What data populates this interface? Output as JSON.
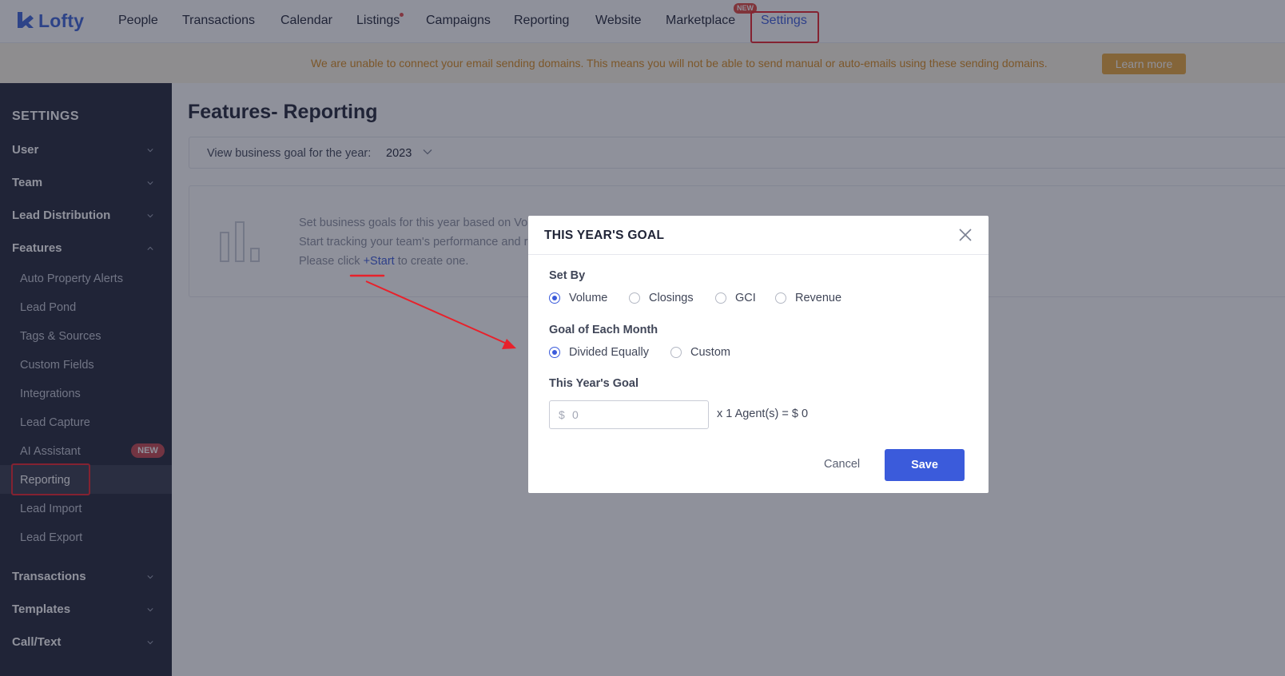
{
  "brand": {
    "name": "Lofty",
    "color": "#3b62d8"
  },
  "topnav": {
    "items": [
      {
        "label": "People"
      },
      {
        "label": "Transactions"
      },
      {
        "label": "Calendar"
      },
      {
        "label": "Listings"
      },
      {
        "label": "Campaigns"
      },
      {
        "label": "Reporting"
      },
      {
        "label": "Website"
      },
      {
        "label": "Marketplace",
        "badge": "NEW"
      },
      {
        "label": "Settings",
        "active": true
      }
    ]
  },
  "banner": {
    "message": "We are unable to connect your email sending domains. This means you will not be able to send manual or auto-emails using these sending domains.",
    "button": "Learn more"
  },
  "sidebar": {
    "title": "SETTINGS",
    "groups": [
      {
        "label": "User",
        "expanded": false
      },
      {
        "label": "Team",
        "expanded": false
      },
      {
        "label": "Lead Distribution",
        "expanded": false
      },
      {
        "label": "Features",
        "expanded": true
      },
      {
        "label": "Transactions",
        "expanded": false
      },
      {
        "label": "Templates",
        "expanded": false
      },
      {
        "label": "Call/Text",
        "expanded": false
      }
    ],
    "feature_items": [
      {
        "label": "Auto Property Alerts"
      },
      {
        "label": "Lead Pond"
      },
      {
        "label": "Tags & Sources"
      },
      {
        "label": "Custom Fields"
      },
      {
        "label": "Integrations"
      },
      {
        "label": "Lead Capture"
      },
      {
        "label": "AI Assistant",
        "badge": "NEW"
      },
      {
        "label": "Reporting",
        "active": true
      },
      {
        "label": "Lead Import"
      },
      {
        "label": "Lead Export"
      }
    ]
  },
  "main": {
    "title": "Features- Reporting",
    "year_label": "View business goal for the year:",
    "year_value": "2023",
    "empty_state": {
      "line1": "Set business goals for this year based on Volu",
      "line2": "Start tracking your team's performance and re",
      "line3_prefix": "Please click ",
      "line3_link": "+Start",
      "line3_suffix": " to create one."
    }
  },
  "modal": {
    "title": "THIS YEAR'S GOAL",
    "set_by_label": "Set By",
    "set_by_options": [
      {
        "label": "Volume",
        "checked": true
      },
      {
        "label": "Closings",
        "checked": false
      },
      {
        "label": "GCI",
        "checked": false
      },
      {
        "label": "Revenue",
        "checked": false
      }
    ],
    "monthly_label": "Goal of Each Month",
    "monthly_options": [
      {
        "label": "Divided Equally",
        "checked": true
      },
      {
        "label": "Custom",
        "checked": false
      }
    ],
    "goal_label": "This Year's Goal",
    "goal_prefix": "$",
    "goal_placeholder": "0",
    "goal_calc": "x 1 Agent(s) = $ 0",
    "cancel": "Cancel",
    "save": "Save"
  },
  "colors": {
    "primary": "#3b5bdb",
    "sidebar_bg": "#202437",
    "banner_text": "#d98b1c",
    "banner_button": "#e8a73a",
    "annotation_red": "#e8212b"
  }
}
